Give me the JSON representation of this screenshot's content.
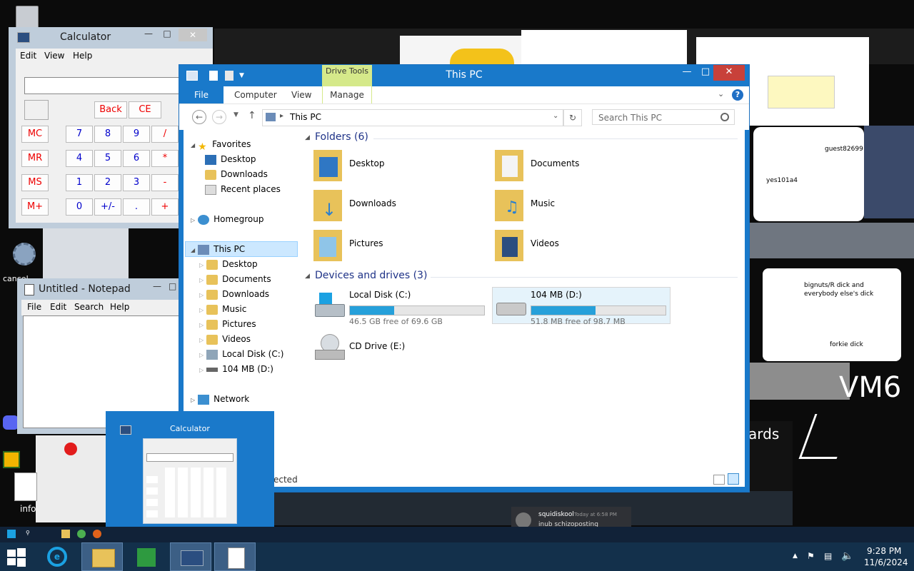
{
  "explorer": {
    "title": "This PC",
    "drive_tools": "Drive Tools",
    "tabs": [
      "File",
      "Computer",
      "View",
      "Manage"
    ],
    "address": "This PC",
    "search_placeholder": "Search This PC",
    "status_partial": "ected",
    "nav": {
      "favorites": "Favorites",
      "fav_items": [
        "Desktop",
        "Downloads",
        "Recent places"
      ],
      "homegroup": "Homegroup",
      "this_pc": "This PC",
      "pc_items": [
        "Desktop",
        "Documents",
        "Downloads",
        "Music",
        "Pictures",
        "Videos",
        "Local Disk (C:)",
        "104 MB (D:)"
      ],
      "network": "Network"
    },
    "folders_header": "Folders (6)",
    "folders": [
      "Desktop",
      "Documents",
      "Downloads",
      "Music",
      "Pictures",
      "Videos"
    ],
    "devices_header": "Devices and drives (3)",
    "drives": [
      {
        "name": "Local Disk (C:)",
        "free": "46.5 GB free of 69.6 GB",
        "used_fraction": 0.33
      },
      {
        "name": "104 MB (D:)",
        "free": "51.8 MB free of 98.7 MB",
        "used_fraction": 0.48
      }
    ],
    "cd_drive": "CD Drive (E:)"
  },
  "calculator": {
    "title": "Calculator",
    "menu": [
      "Edit",
      "View",
      "Help"
    ],
    "top_buttons": [
      "Back",
      "CE"
    ],
    "memory_buttons": [
      "MC",
      "MR",
      "MS",
      "M+"
    ],
    "rows": [
      [
        "7",
        "8",
        "9",
        "/"
      ],
      [
        "4",
        "5",
        "6",
        "*"
      ],
      [
        "1",
        "2",
        "3",
        "-"
      ],
      [
        "0",
        "+/-",
        ".",
        "+"
      ]
    ]
  },
  "notepad": {
    "title": "Untitled - Notepad",
    "menu": [
      "File",
      "Edit",
      "Search",
      "Help"
    ]
  },
  "thumbnail": {
    "title": "Calculator"
  },
  "chat": {
    "user": "squidiskool",
    "time": "Today at 6:58 PM",
    "message": "inub schizoposting"
  },
  "wallpaper_text": {
    "vm": "VM6",
    "ards": "ards",
    "dick1": "bignuts/R dick and everybody else's dick",
    "dick2": "forkie dick",
    "guest": "guest82699",
    "yes": "yes101a4",
    "desk_label_info": "info",
    "desk_label_cancel": "cancel"
  },
  "taskbar": {
    "time": "9:28 PM",
    "date": "11/6/2024"
  }
}
